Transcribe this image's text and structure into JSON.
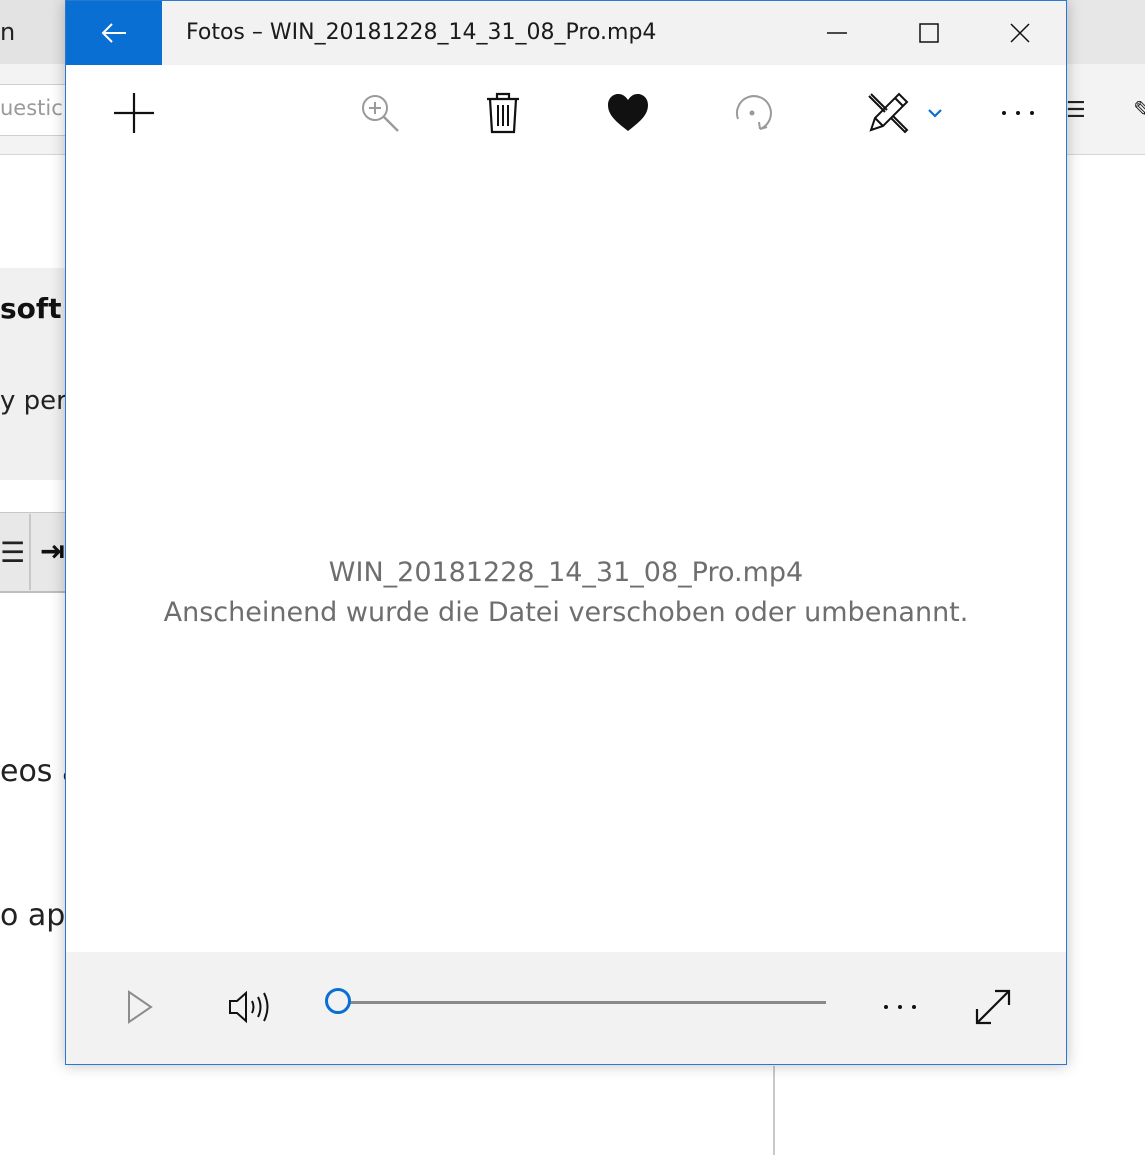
{
  "background_app": {
    "tab_fragment": "n",
    "search_placeholder_fragment": "uestic",
    "heading_fragment": "soft C",
    "subtext_fragment": "y per",
    "line1_fragment": "eos a",
    "line2_fragment": "o ap",
    "toolbar_icon1": "☰",
    "toolbar_icon2": "⇥",
    "right_icon1": "☰",
    "right_icon2": "✎"
  },
  "window": {
    "title": "Fotos – WIN_20181228_14_31_08_Pro.mp4",
    "accent_color": "#0a6fd3"
  },
  "toolbar": {
    "add": "Add",
    "zoom": "Zoom",
    "delete": "Delete",
    "favorite": "Favorite",
    "rotate": "Rotate",
    "edit": "Edit & Create",
    "more": "See more"
  },
  "message": {
    "filename": "WIN_20181228_14_31_08_Pro.mp4",
    "error": "Anscheinend wurde die Datei verschoben oder umbenannt."
  },
  "player": {
    "progress": 0,
    "more_label": "···"
  }
}
